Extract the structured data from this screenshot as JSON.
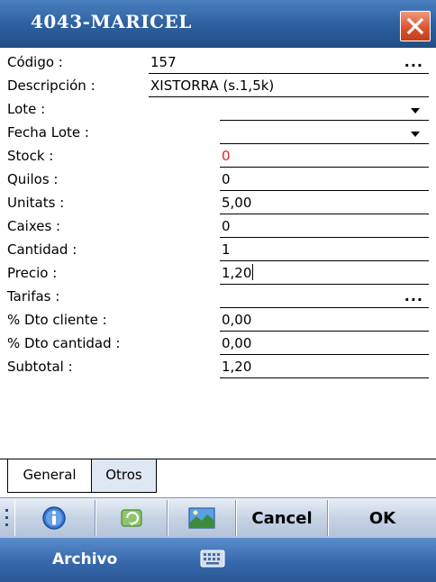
{
  "window": {
    "title": "4043-MARICEL",
    "close_glyph": "close-icon"
  },
  "form": {
    "codigo": {
      "label": "Código :",
      "value": "157",
      "more": "..."
    },
    "descripcion": {
      "label": "Descripción :",
      "value": "XISTORRA (s.1,5k)"
    },
    "lote": {
      "label": "Lote :",
      "value": ""
    },
    "fecha_lote": {
      "label": "Fecha Lote :",
      "value": ""
    },
    "stock": {
      "label": "Stock :",
      "value": "0",
      "color": "#e0281e"
    },
    "quilos": {
      "label": "Quilos :",
      "value": "0"
    },
    "unitats": {
      "label": "Unitats :",
      "value": "5,00"
    },
    "caixes": {
      "label": "Caixes :",
      "value": "0"
    },
    "cantidad": {
      "label": "Cantidad :",
      "value": "1"
    },
    "precio": {
      "label": "Precio :",
      "value": "1,20"
    },
    "tarifas": {
      "label": "Tarifas :",
      "value": "",
      "more": "..."
    },
    "dto_cliente": {
      "label": "% Dto cliente :",
      "value": "0,00"
    },
    "dto_cantidad": {
      "label": "% Dto cantidad :",
      "value": "0,00"
    },
    "subtotal": {
      "label": "Subtotal :",
      "value": "1,20"
    }
  },
  "tabs": [
    {
      "label": "General",
      "active": true
    },
    {
      "label": "Otros",
      "active": false
    }
  ],
  "toolbar": {
    "info_icon": "info-icon",
    "refresh_icon": "refresh-icon",
    "image_icon": "image-icon",
    "cancel_label": "Cancel",
    "ok_label": "OK"
  },
  "menubar": {
    "menu_label": "Archivo",
    "keyboard_icon": "keyboard-icon"
  }
}
